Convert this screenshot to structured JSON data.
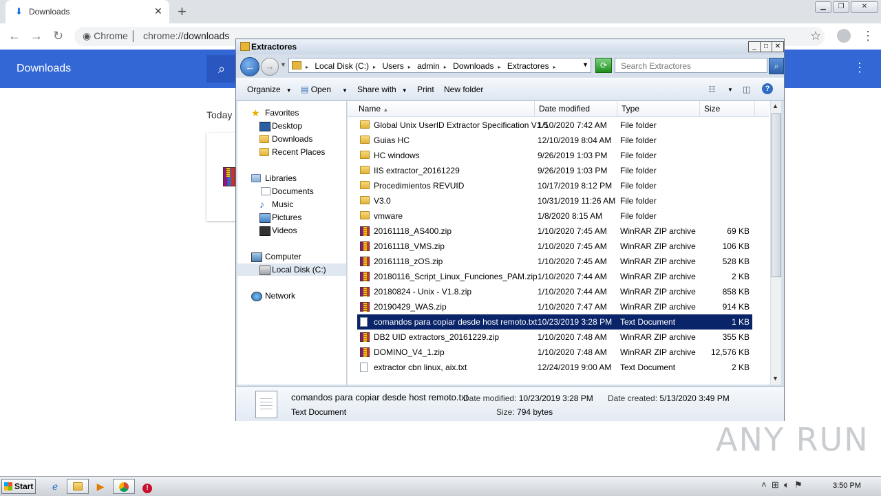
{
  "browser": {
    "tab_title": "Downloads",
    "site_label": "Chrome",
    "url_scheme": "chrome://",
    "url_rest": "downloads",
    "page_title": "Downloads",
    "section_today": "Today"
  },
  "explorer": {
    "title": "Extractores",
    "breadcrumbs": [
      "Local Disk (C:)",
      "Users",
      "admin",
      "Downloads",
      "Extractores"
    ],
    "search_placeholder": "Search Extractores",
    "commands": {
      "organize": "Organize",
      "open": "Open",
      "share_with": "Share with",
      "print": "Print",
      "new_folder": "New folder"
    },
    "nav": {
      "favorites": "Favorites",
      "desktop": "Desktop",
      "downloads": "Downloads",
      "recent_places": "Recent Places",
      "libraries": "Libraries",
      "documents": "Documents",
      "music": "Music",
      "pictures": "Pictures",
      "videos": "Videos",
      "computer": "Computer",
      "local_disk": "Local Disk (C:)",
      "network": "Network"
    },
    "columns": {
      "name": "Name",
      "date": "Date modified",
      "type": "Type",
      "size": "Size"
    },
    "files": [
      {
        "name": "Global Unix UserID Extractor Specification V1.5",
        "date": "1/10/2020 7:42 AM",
        "type": "File folder",
        "size": "",
        "icon": "folder"
      },
      {
        "name": "Guias HC",
        "date": "12/10/2019 8:04 AM",
        "type": "File folder",
        "size": "",
        "icon": "folder"
      },
      {
        "name": "HC windows",
        "date": "9/26/2019 1:03 PM",
        "type": "File folder",
        "size": "",
        "icon": "folder"
      },
      {
        "name": "IIS extractor_20161229",
        "date": "9/26/2019 1:03 PM",
        "type": "File folder",
        "size": "",
        "icon": "folder"
      },
      {
        "name": "Procedimientos REVUID",
        "date": "10/17/2019 8:12 PM",
        "type": "File folder",
        "size": "",
        "icon": "folder"
      },
      {
        "name": "V3.0",
        "date": "10/31/2019 11:26 AM",
        "type": "File folder",
        "size": "",
        "icon": "folder"
      },
      {
        "name": "vmware",
        "date": "1/8/2020 8:15 AM",
        "type": "File folder",
        "size": "",
        "icon": "folder"
      },
      {
        "name": "20161118_AS400.zip",
        "date": "1/10/2020 7:45 AM",
        "type": "WinRAR ZIP archive",
        "size": "69 KB",
        "icon": "zip"
      },
      {
        "name": "20161118_VMS.zip",
        "date": "1/10/2020 7:45 AM",
        "type": "WinRAR ZIP archive",
        "size": "106 KB",
        "icon": "zip"
      },
      {
        "name": "20161118_zOS.zip",
        "date": "1/10/2020 7:45 AM",
        "type": "WinRAR ZIP archive",
        "size": "528 KB",
        "icon": "zip"
      },
      {
        "name": "20180116_Script_Linux_Funciones_PAM.zip",
        "date": "1/10/2020 7:44 AM",
        "type": "WinRAR ZIP archive",
        "size": "2 KB",
        "icon": "zip"
      },
      {
        "name": "20180824 - Unix - V1.8.zip",
        "date": "1/10/2020 7:44 AM",
        "type": "WinRAR ZIP archive",
        "size": "858 KB",
        "icon": "zip"
      },
      {
        "name": "20190429_WAS.zip",
        "date": "1/10/2020 7:47 AM",
        "type": "WinRAR ZIP archive",
        "size": "914 KB",
        "icon": "zip"
      },
      {
        "name": "comandos para copiar desde host remoto.txt",
        "date": "10/23/2019 3:28 PM",
        "type": "Text Document",
        "size": "1 KB",
        "icon": "txt",
        "selected": true
      },
      {
        "name": "DB2 UID extractors_20161229.zip",
        "date": "1/10/2020 7:48 AM",
        "type": "WinRAR ZIP archive",
        "size": "355 KB",
        "icon": "zip"
      },
      {
        "name": "DOMINO_V4_1.zip",
        "date": "1/10/2020 7:48 AM",
        "type": "WinRAR ZIP archive",
        "size": "12,576 KB",
        "icon": "zip"
      },
      {
        "name": "extractor cbn linux, aix.txt",
        "date": "12/24/2019 9:00 AM",
        "type": "Text Document",
        "size": "2 KB",
        "icon": "txt"
      }
    ],
    "details": {
      "filename": "comandos para copiar desde host remoto.txt",
      "type": "Text Document",
      "modified_label": "Date modified:",
      "modified_value": "10/23/2019 3:28 PM",
      "created_label": "Date created:",
      "created_value": "5/13/2020 3:49 PM",
      "size_label": "Size:",
      "size_value": "794 bytes"
    }
  },
  "taskbar": {
    "start": "Start",
    "clock": "3:50 PM"
  },
  "watermark": "ANY RUN"
}
